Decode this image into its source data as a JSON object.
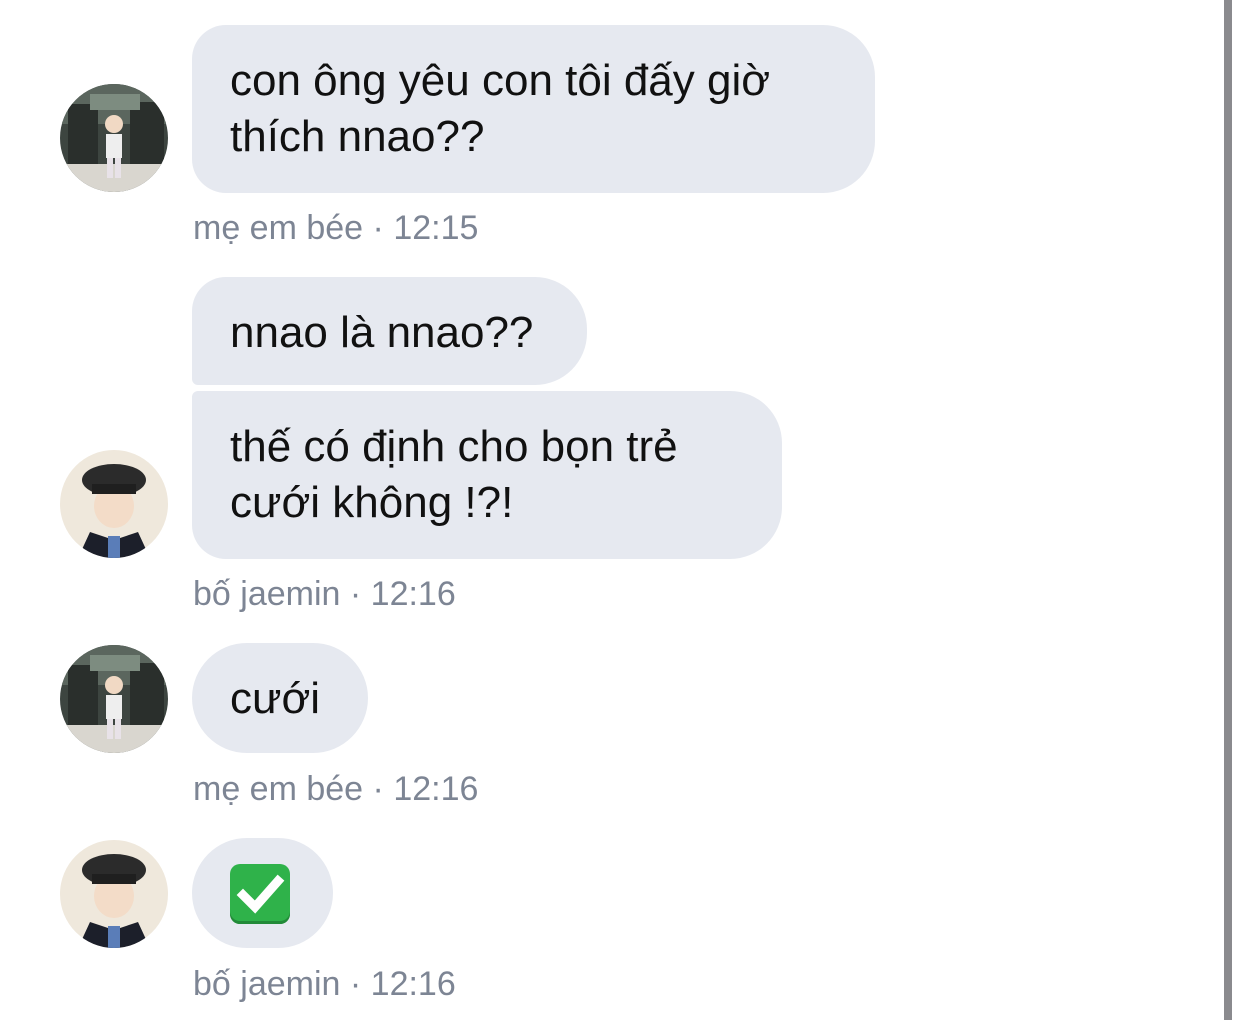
{
  "messages": [
    {
      "lines": [
        "con ông yêu con tôi đấy giờ",
        "thích nnao??"
      ],
      "sender": "mẹ em bée",
      "time": "12:15"
    },
    {
      "lines": [
        "nnao là nnao??"
      ]
    },
    {
      "lines": [
        "thế có định cho bọn trẻ",
        "cưới không !?!"
      ],
      "sender": "bố jaemin",
      "time": "12:16"
    },
    {
      "lines": [
        "cưới"
      ],
      "sender": "mẹ em bée",
      "time": "12:16"
    },
    {
      "emoji": "check-mark-button",
      "sender": "bố jaemin",
      "time": "12:16"
    }
  ],
  "separator": "·",
  "colors": {
    "bubble": "#e6e9f0",
    "meta_text": "#7d8594",
    "message_text": "#111111",
    "check_green": "#2fb24a",
    "scrollbar": "#8a8a8e"
  }
}
